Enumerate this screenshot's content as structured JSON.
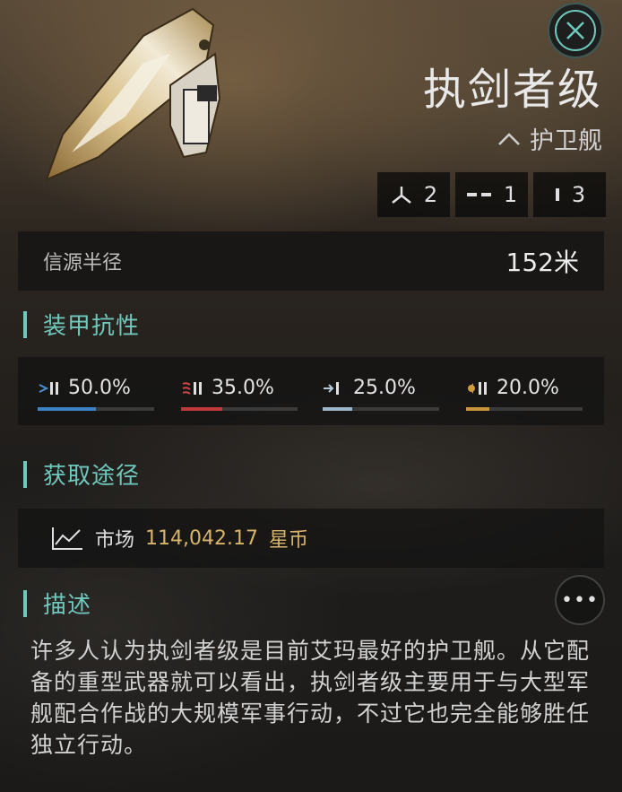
{
  "ship": {
    "name": "执剑者级",
    "class": "护卫舰",
    "class_icon": "triangle-up-icon"
  },
  "slots": [
    {
      "icon": "turret-hardpoint-icon",
      "count": "2"
    },
    {
      "icon": "launcher-hardpoint-icon",
      "count": "1"
    },
    {
      "icon": "utility-slot-icon",
      "count": "3"
    }
  ],
  "signature": {
    "label": "信源半径",
    "value": "152米"
  },
  "resistance_section": {
    "title": "装甲抗性",
    "items": [
      {
        "type": "em",
        "value": "50.0%",
        "fraction": 0.5,
        "color": "#3b82c4"
      },
      {
        "type": "thermal",
        "value": "35.0%",
        "fraction": 0.35,
        "color": "#c0393b"
      },
      {
        "type": "kinetic",
        "value": "25.0%",
        "fraction": 0.25,
        "color": "#9fb6c8"
      },
      {
        "type": "explosive",
        "value": "20.0%",
        "fraction": 0.2,
        "color": "#c8963a"
      }
    ]
  },
  "acquisition_section": {
    "title": "获取途径",
    "market_label": "市场",
    "price": "114,042.17",
    "currency": "星币"
  },
  "description_section": {
    "title": "描述",
    "more_label": "•••",
    "text": "许多人认为执剑者级是目前艾玛最好的护卫舰。从它配备的重型武器就可以看出，执剑者级主要用于与大型军舰配合作战的大规模军事行动，不过它也完全能够胜任独立行动。"
  },
  "colors": {
    "accent": "#6fc8bc",
    "price": "#d8b46a"
  }
}
